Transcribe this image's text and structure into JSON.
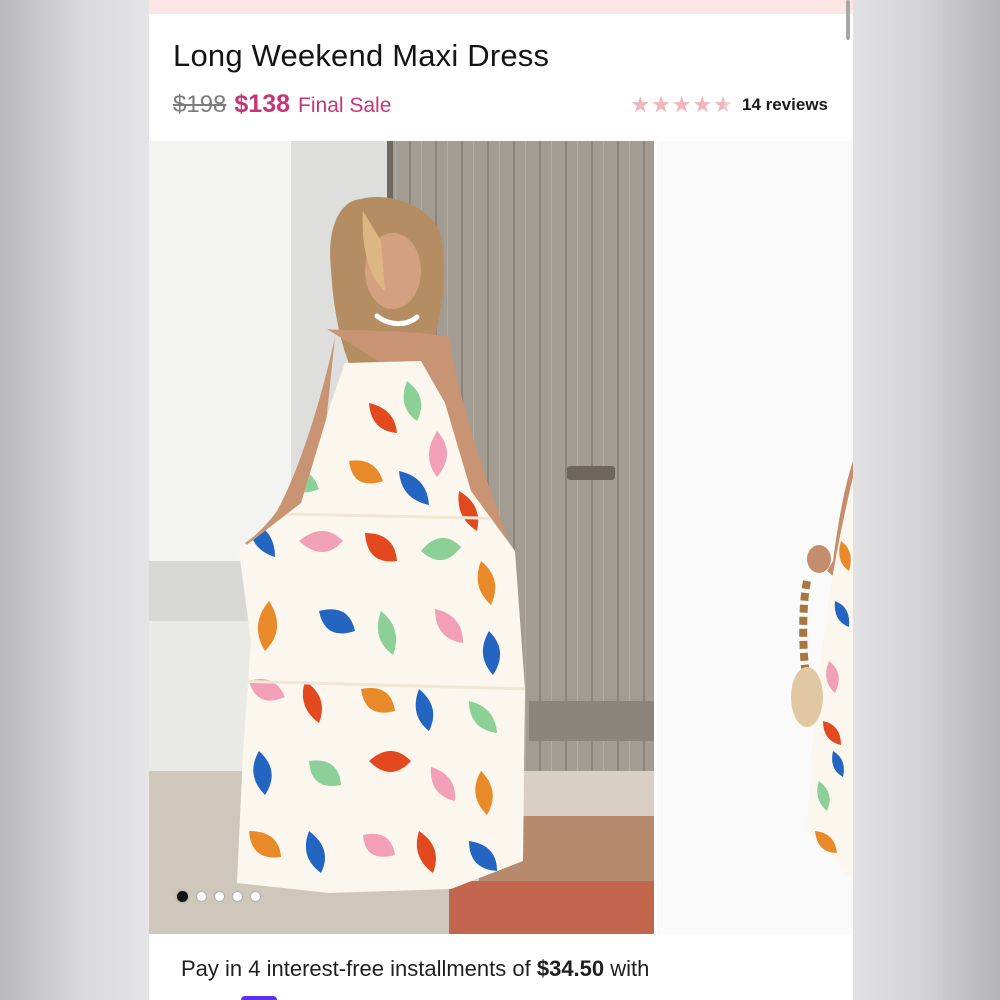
{
  "product": {
    "title": "Long Weekend Maxi Dress",
    "original_price": "$198",
    "sale_price": "$138",
    "sale_label": "Final Sale",
    "rating": 4.5,
    "rating_max": 5,
    "reviews_label": "14 reviews"
  },
  "gallery": {
    "slide_count": 5,
    "active_index": 0
  },
  "payment": {
    "prefix": "Pay in 4 interest-free installments of",
    "amount": "$34.50",
    "suffix": "with"
  },
  "colors": {
    "sale_pink": "#c53577",
    "star_pink": "#f2b5bd",
    "installment_brand": "#5a31f4",
    "top_banner": "#fbe6e5"
  },
  "icons": {
    "star": "star-icon",
    "pagination_dot": "dot-icon"
  }
}
